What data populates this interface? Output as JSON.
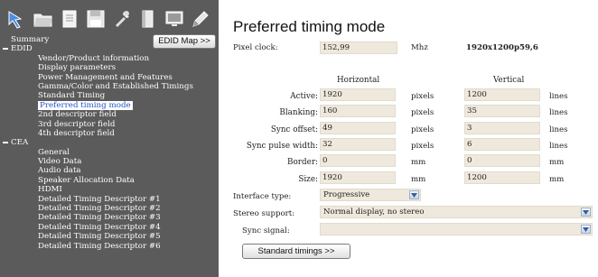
{
  "sidebar": {
    "edid_map_button": "EDID Map >>",
    "toolbar_icons": [
      "blue-arrow-icon",
      "folder-icon",
      "document-icon",
      "save-icon",
      "tools-icon",
      "book-icon",
      "monitor-icon",
      "edit-icon"
    ],
    "tree": [
      {
        "label": "Summary",
        "level": 0
      },
      {
        "label": "EDID",
        "level": "section"
      },
      {
        "label": "Vendor/Product information",
        "level": 1
      },
      {
        "label": "Display parameters",
        "level": 1
      },
      {
        "label": "Power Management and Features",
        "level": 1
      },
      {
        "label": "Gamma/Color and Established Timings",
        "level": 1
      },
      {
        "label": "Standard Timing",
        "level": 1
      },
      {
        "label": "Preferred timing mode",
        "level": 1,
        "selected": true
      },
      {
        "label": "2nd descriptor field",
        "level": 1
      },
      {
        "label": "3rd descriptor field",
        "level": 1
      },
      {
        "label": "4th descriptor field",
        "level": 1
      },
      {
        "label": "CEA",
        "level": "section"
      },
      {
        "label": "General",
        "level": 1
      },
      {
        "label": "Video Data",
        "level": 1
      },
      {
        "label": "Audio data",
        "level": 1
      },
      {
        "label": "Speaker Allocation Data",
        "level": 1
      },
      {
        "label": "HDMI",
        "level": 1
      },
      {
        "label": "Detailed Timing Descriptor #1",
        "level": 1
      },
      {
        "label": "Detailed Timing Descriptor #2",
        "level": 1
      },
      {
        "label": "Detailed Timing Descriptor #3",
        "level": 1
      },
      {
        "label": "Detailed Timing Descriptor #4",
        "level": 1
      },
      {
        "label": "Detailed Timing Descriptor #5",
        "level": 1
      },
      {
        "label": "Detailed Timing Descriptor #6",
        "level": 1
      }
    ]
  },
  "main": {
    "title": "Preferred timing mode",
    "pixel_clock": {
      "label": "Pixel clock:",
      "value": "152,99",
      "unit": "Mhz",
      "mode": "1920x1200p59,6"
    },
    "headers": {
      "horizontal": "Horizontal",
      "vertical": "Vertical"
    },
    "rows": [
      {
        "label": "Active:",
        "h": "1920",
        "h_unit": "pixels",
        "v": "1200",
        "v_unit": "lines"
      },
      {
        "label": "Blanking:",
        "h": "160",
        "h_unit": "pixels",
        "v": "35",
        "v_unit": "lines"
      },
      {
        "label": "Sync offset:",
        "h": "49",
        "h_unit": "pixels",
        "v": "3",
        "v_unit": "lines"
      },
      {
        "label": "Sync pulse width:",
        "h": "32",
        "h_unit": "pixels",
        "v": "6",
        "v_unit": "lines"
      },
      {
        "label": "Border:",
        "h": "0",
        "h_unit": "mm",
        "v": "0",
        "v_unit": "mm"
      },
      {
        "label": "Size:",
        "h": "1920",
        "h_unit": "mm",
        "v": "1200",
        "v_unit": "mm"
      }
    ],
    "interface_type": {
      "label": "Interface type:",
      "value": "Progressive"
    },
    "stereo_support": {
      "label": "Stereo support:",
      "value": "Normal display, no stereo"
    },
    "sync_signal": {
      "label": "Sync signal:",
      "value": ""
    },
    "standard_timings_button": "Standard timings >>"
  }
}
